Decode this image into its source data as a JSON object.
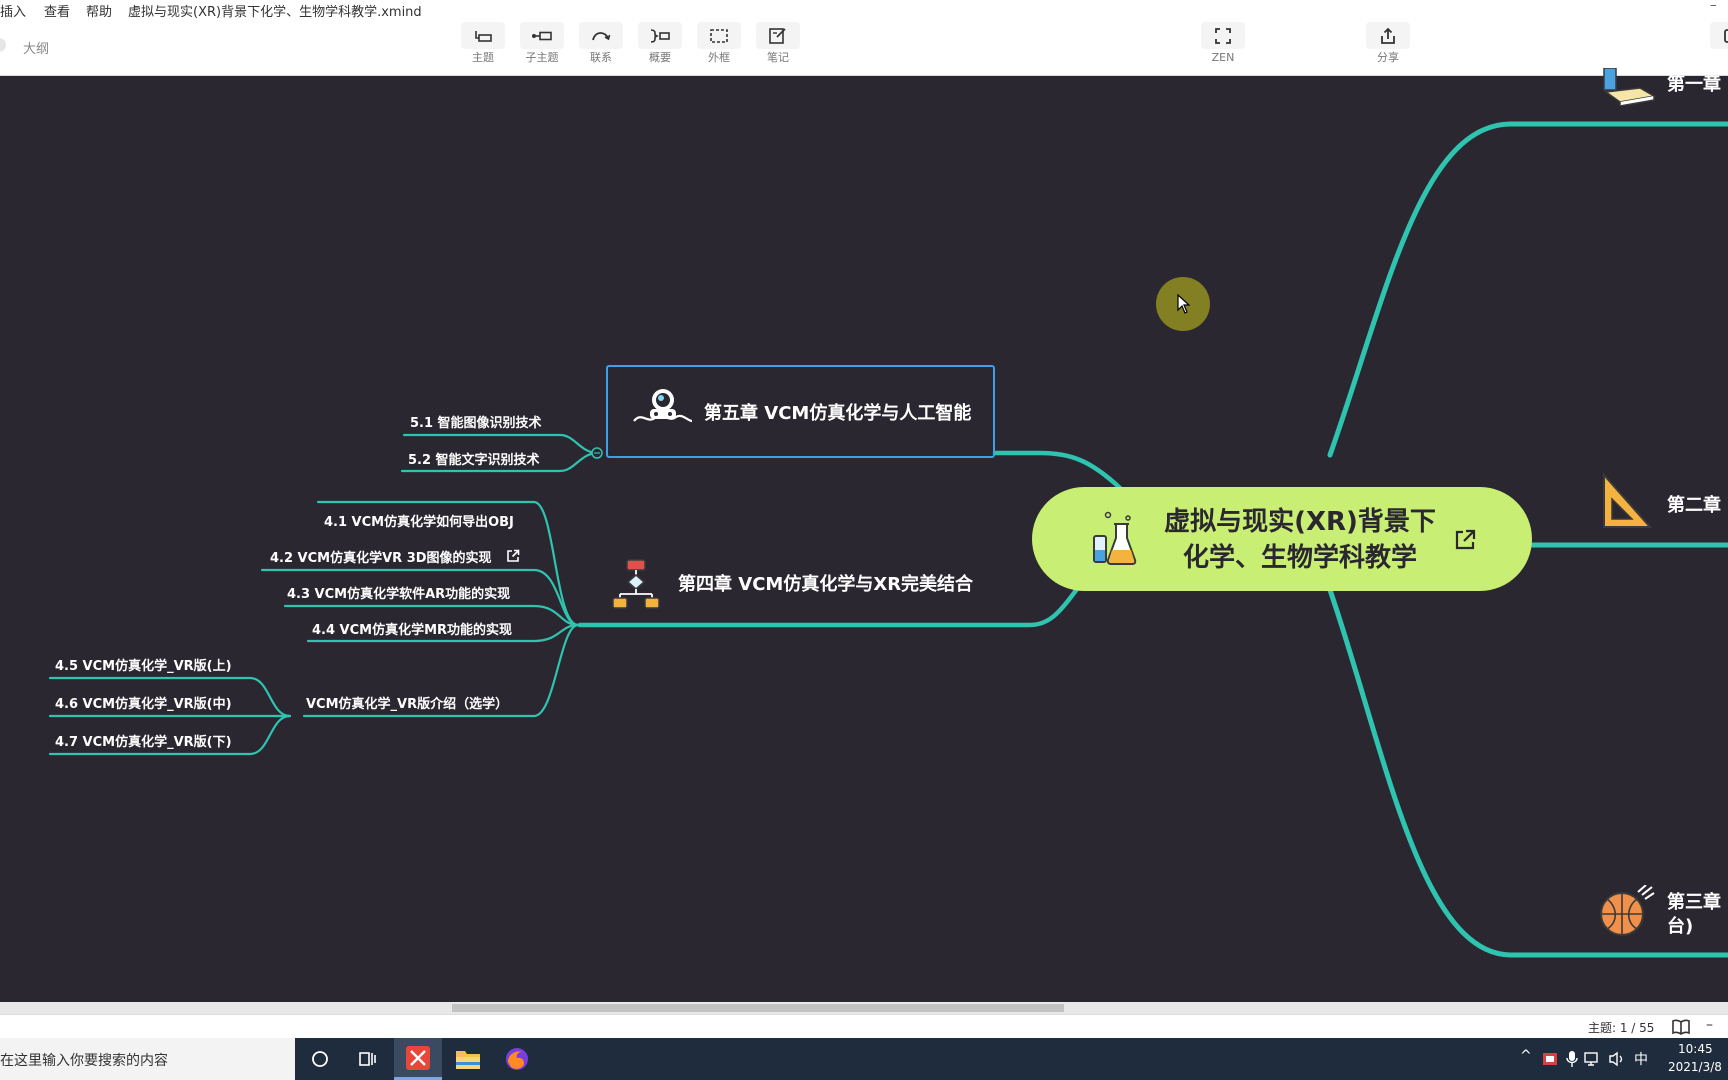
{
  "window": {
    "title": "虚拟与现实(XR)背景下化学、生物学科教学.xmind",
    "menu": [
      "插入",
      "查看",
      "帮助"
    ]
  },
  "sidebar": {
    "outline_label": "大纲"
  },
  "toolbar": {
    "tools": [
      {
        "label": "主题",
        "icon": "topic-icon"
      },
      {
        "label": "子主题",
        "icon": "subtopic-icon"
      },
      {
        "label": "联系",
        "icon": "relationship-icon"
      },
      {
        "label": "概要",
        "icon": "summary-icon"
      },
      {
        "label": "外框",
        "icon": "boundary-icon"
      },
      {
        "label": "笔记",
        "icon": "note-icon"
      }
    ],
    "zen_label": "ZEN",
    "share_label": "分享"
  },
  "mindmap": {
    "root": {
      "line1": "虚拟与现实(XR)背景下",
      "line2": "化学、生物学科教学"
    },
    "chapter5": {
      "title": "第五章  VCM仿真化学与人工智能",
      "children": [
        "5.1  智能图像识别技术",
        "5.2  智能文字识别技术"
      ]
    },
    "chapter4": {
      "title": "第四章  VCM仿真化学与XR完美结合",
      "children": [
        "4.1  VCM仿真化学如何导出OBJ",
        "4.2 VCM仿真化学VR 3D图像的实现",
        "4.3  VCM仿真化学软件AR功能的实现",
        "4.4  VCM仿真化学MR功能的实现",
        "VCM仿真化学_VR版介绍（选学）"
      ],
      "vr_children": [
        "4.5  VCM仿真化学_VR版(上)",
        "4.6  VCM仿真化学_VR版(中)",
        "4.7  VCM仿真化学_VR版(下)"
      ]
    },
    "right": {
      "chapter1": "第一章",
      "chapter2": "第二章",
      "chapter3_line1": "第三章",
      "chapter3_line2": "台)"
    }
  },
  "status": {
    "topic_count": "主题: 1 / 55"
  },
  "taskbar": {
    "search_placeholder": "在这里输入你要搜索的内容",
    "ime": "中",
    "time": "10:45",
    "date": "2021/3/8"
  },
  "colors": {
    "canvas": "#2a2730",
    "branch": "#2ec4b0",
    "root_fill": "#c8ee74",
    "selection": "#3aa2e8"
  }
}
